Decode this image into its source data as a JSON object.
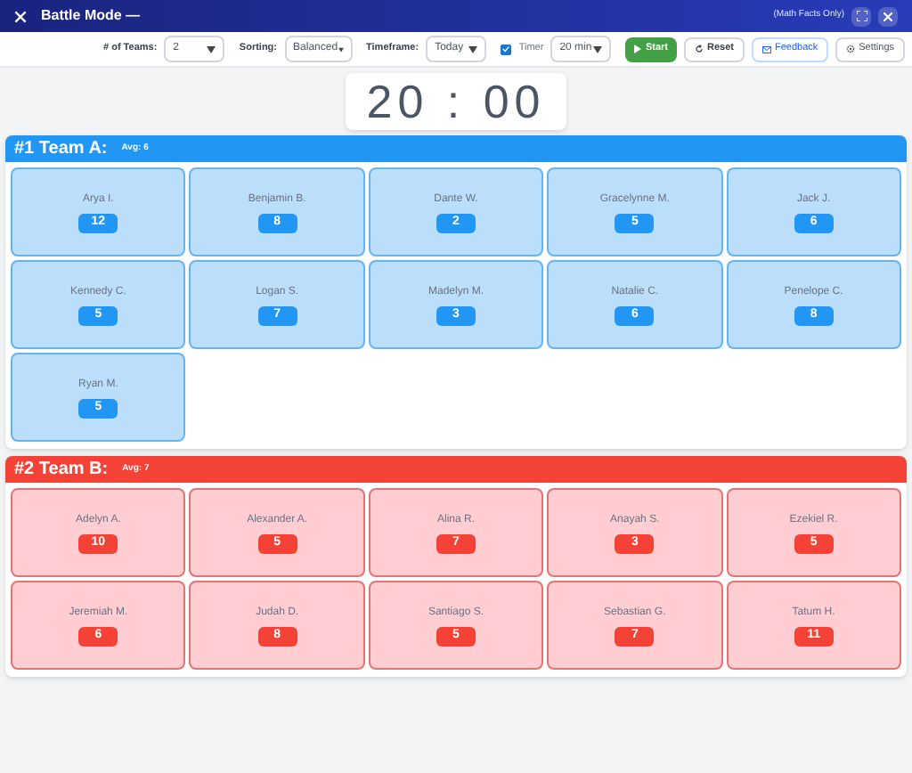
{
  "header": {
    "title": "Battle Mode —",
    "subtitle": "(Math Facts Only)"
  },
  "toolbar": {
    "teams_label": "# of Teams:",
    "teams_value": "2",
    "sorting_label": "Sorting:",
    "sorting_value": "Balanced",
    "timeframe_label": "Timeframe:",
    "timeframe_value": "Today",
    "timer_label": "Timer",
    "timer_checked": true,
    "timer_value": "20 min",
    "start": "Start",
    "reset": "Reset",
    "feedback": "Feedback",
    "settings": "Settings"
  },
  "timer": "20 : 00",
  "teams": [
    {
      "title": "#1 Team A:",
      "avg": "Avg: 6",
      "color": "#2196f3",
      "students": [
        {
          "name": "Arya I.",
          "score": "12"
        },
        {
          "name": "Benjamin B.",
          "score": "8"
        },
        {
          "name": "Dante W.",
          "score": "2"
        },
        {
          "name": "Gracelynne M.",
          "score": "5"
        },
        {
          "name": "Jack J.",
          "score": "6"
        },
        {
          "name": "Kennedy C.",
          "score": "5"
        },
        {
          "name": "Logan S.",
          "score": "7"
        },
        {
          "name": "Madelyn M.",
          "score": "3"
        },
        {
          "name": "Natalie C.",
          "score": "6"
        },
        {
          "name": "Penelope C.",
          "score": "8"
        },
        {
          "name": "Ryan M.",
          "score": "5"
        }
      ]
    },
    {
      "title": "#2 Team B:",
      "avg": "Avg: 7",
      "color": "#f44336",
      "students": [
        {
          "name": "Adelyn A.",
          "score": "10"
        },
        {
          "name": "Alexander A.",
          "score": "5"
        },
        {
          "name": "Alina R.",
          "score": "7"
        },
        {
          "name": "Anayah S.",
          "score": "3"
        },
        {
          "name": "Ezekiel R.",
          "score": "5"
        },
        {
          "name": "Jeremiah M.",
          "score": "6"
        },
        {
          "name": "Judah D.",
          "score": "8"
        },
        {
          "name": "Santiago S.",
          "score": "5"
        },
        {
          "name": "Sebastian G.",
          "score": "7"
        },
        {
          "name": "Tatum H.",
          "score": "11"
        }
      ]
    }
  ]
}
